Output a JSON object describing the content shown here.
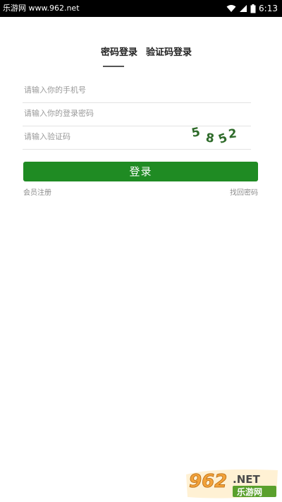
{
  "status_bar": {
    "source_text": "乐游网 www.962.net",
    "time": "6:13",
    "icons": [
      "wifi-icon",
      "signal-icon",
      "battery-icon"
    ]
  },
  "tabs": [
    {
      "label": "密码登录",
      "active": true
    },
    {
      "label": "验证码登录",
      "active": false
    }
  ],
  "form": {
    "phone_placeholder": "请输入你的手机号",
    "password_placeholder": "请输入你的登录密码",
    "captcha_placeholder": "请输入验证码",
    "captcha_code": "5852"
  },
  "login_button_label": "登录",
  "register_link": "会员注册",
  "forgot_link": "找回密码",
  "watermark": {
    "logo_number": "962",
    "logo_suffix": ".NET",
    "logo_cn": "乐游网"
  },
  "colors": {
    "accent_green": "#1f8b23",
    "captcha_green": "#2e6b2a",
    "status_bar": "#000000",
    "watermark_orange": "#f2a23a"
  }
}
